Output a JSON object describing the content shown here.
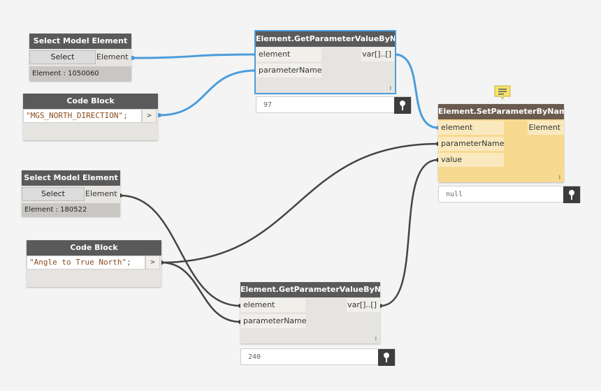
{
  "nodes": {
    "select1": {
      "title": "Select Model Element",
      "button": "Select",
      "output": "Element",
      "info": "Element : 1050060"
    },
    "code1": {
      "title": "Code Block",
      "code": "\"MGS_NORTH_DIRECTION\";",
      "output": ">"
    },
    "getparam1": {
      "title": "Element.GetParameterValueByName",
      "inputs": [
        "element",
        "parameterName"
      ],
      "output": "var[]..[]",
      "lacing": "l",
      "preview": "97"
    },
    "setparam": {
      "title": "Element.SetParameterByName",
      "inputs": [
        "element",
        "parameterName",
        "value"
      ],
      "output": "Element",
      "lacing": "l",
      "preview": "null"
    },
    "select2": {
      "title": "Select Model Element",
      "button": "Select",
      "output": "Element",
      "info": "Element : 180522"
    },
    "code2": {
      "title": "Code Block",
      "code": "\"Angle to True North\";",
      "output": ">"
    },
    "getparam2": {
      "title": "Element.GetParameterValueByName",
      "inputs": [
        "element",
        "parameterName"
      ],
      "output": "var[]..[]",
      "lacing": "l",
      "preview": "240"
    }
  },
  "colors": {
    "node_header": "#5a5a5a",
    "node_body": "#e6e4e1",
    "selected_outline": "#4b9ddb",
    "wire_blue": "#4b9ddb",
    "wire_dark": "#444444",
    "set_node_body": "#f8d990",
    "set_node_port": "#fae9be",
    "set_node_header": "#6b5b4e",
    "note_icon": "#f8e36c"
  },
  "icons": {
    "pin": "pin-icon",
    "note": "note-icon"
  }
}
